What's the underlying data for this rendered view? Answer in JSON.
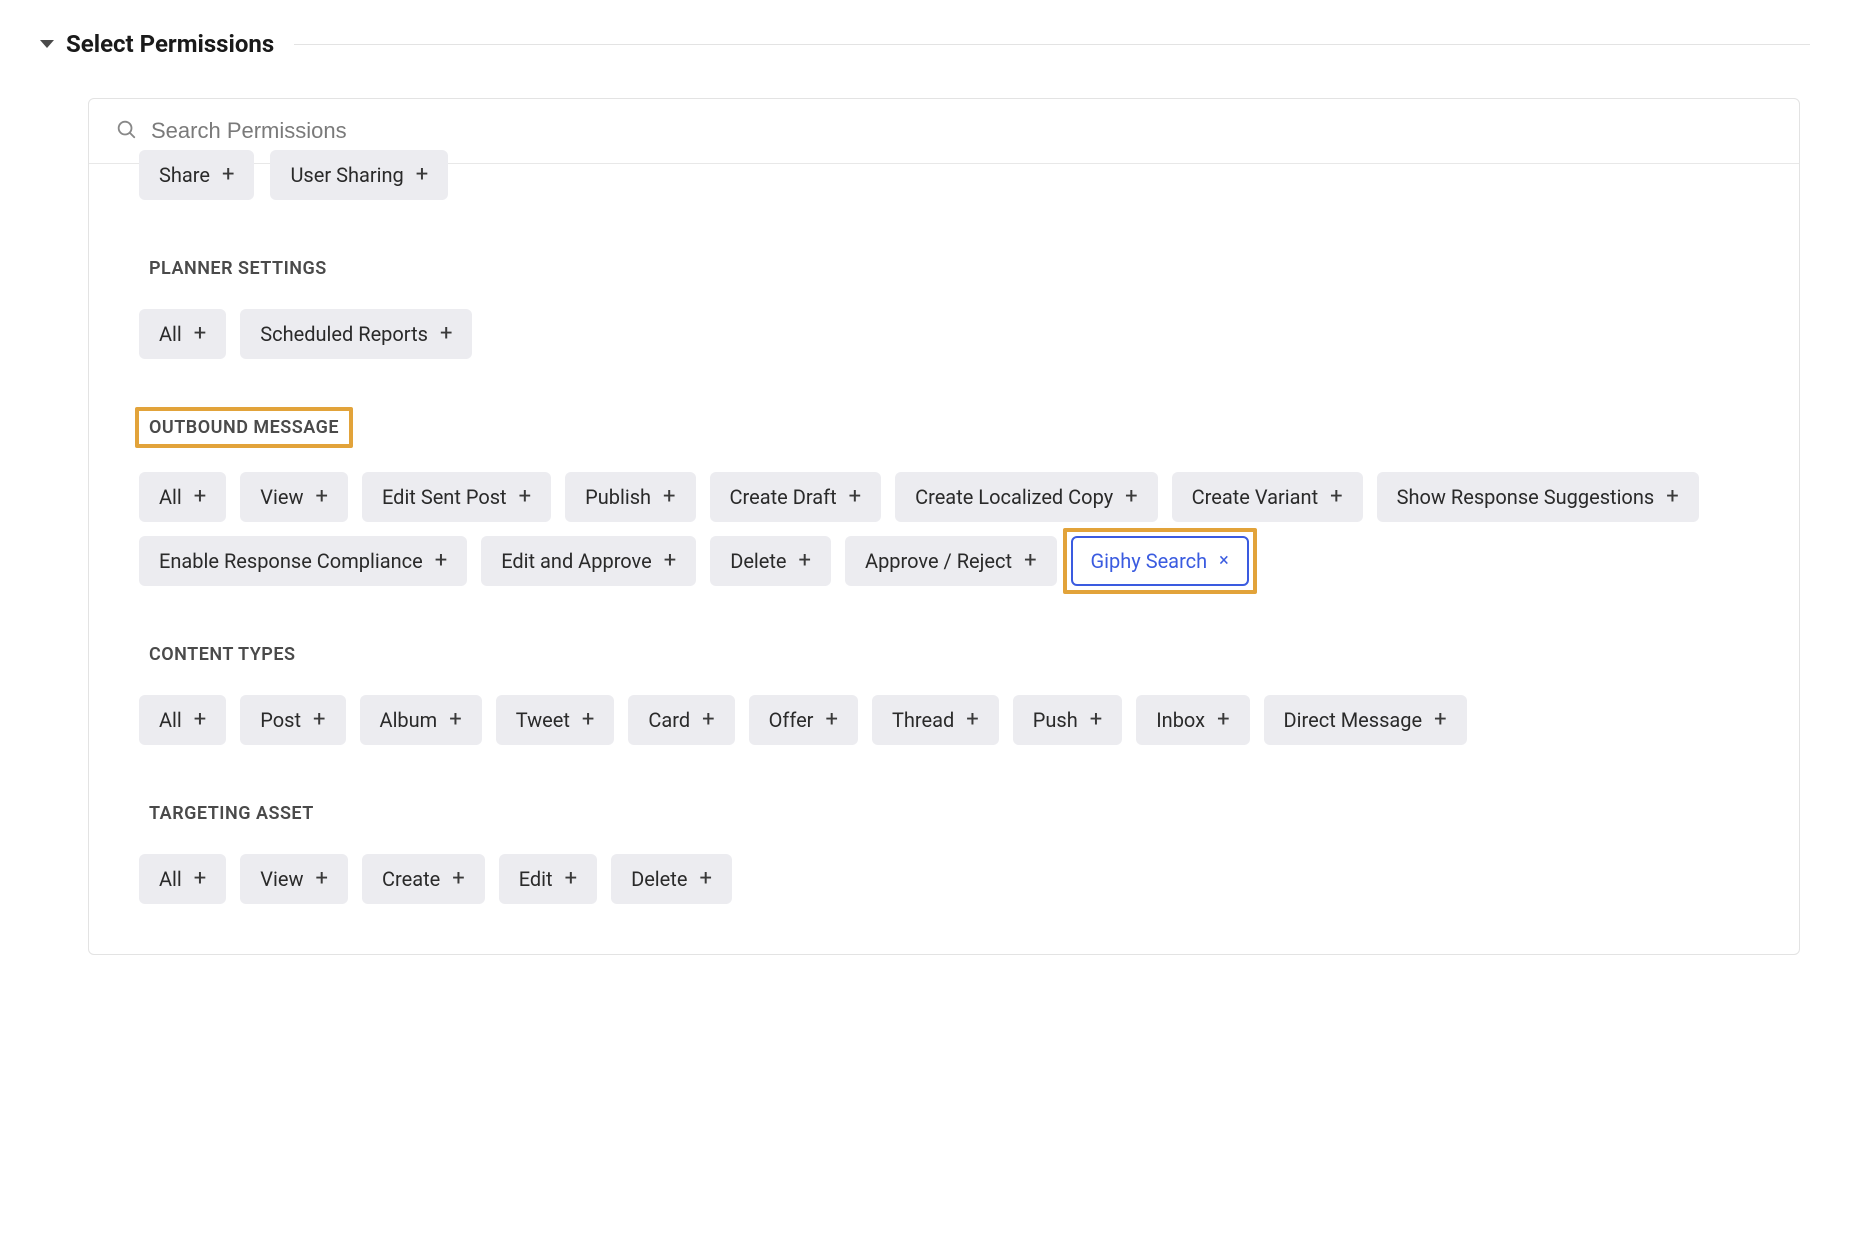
{
  "header": {
    "title": "Select Permissions"
  },
  "search": {
    "placeholder": "Search Permissions"
  },
  "cutoff_row": [
    {
      "label": "Share",
      "icon": "+",
      "selected": false
    },
    {
      "label": "User Sharing",
      "icon": "+",
      "selected": false
    }
  ],
  "groups": [
    {
      "title": "PLANNER SETTINGS",
      "highlighted": false,
      "chips": [
        {
          "label": "All",
          "icon": "+",
          "selected": false,
          "highlighted": false
        },
        {
          "label": "Scheduled Reports",
          "icon": "+",
          "selected": false,
          "highlighted": false
        }
      ]
    },
    {
      "title": "OUTBOUND MESSAGE",
      "highlighted": true,
      "chips": [
        {
          "label": "All",
          "icon": "+",
          "selected": false,
          "highlighted": false
        },
        {
          "label": "View",
          "icon": "+",
          "selected": false,
          "highlighted": false
        },
        {
          "label": "Edit Sent Post",
          "icon": "+",
          "selected": false,
          "highlighted": false
        },
        {
          "label": "Publish",
          "icon": "+",
          "selected": false,
          "highlighted": false
        },
        {
          "label": "Create Draft",
          "icon": "+",
          "selected": false,
          "highlighted": false
        },
        {
          "label": "Create Localized Copy",
          "icon": "+",
          "selected": false,
          "highlighted": false
        },
        {
          "label": "Create Variant",
          "icon": "+",
          "selected": false,
          "highlighted": false
        },
        {
          "label": "Show Response Suggestions",
          "icon": "+",
          "selected": false,
          "highlighted": false
        },
        {
          "label": "Enable Response Compliance",
          "icon": "+",
          "selected": false,
          "highlighted": false
        },
        {
          "label": "Edit and Approve",
          "icon": "+",
          "selected": false,
          "highlighted": false
        },
        {
          "label": "Delete",
          "icon": "+",
          "selected": false,
          "highlighted": false
        },
        {
          "label": "Approve / Reject",
          "icon": "+",
          "selected": false,
          "highlighted": false
        },
        {
          "label": "Giphy Search",
          "icon": "×",
          "selected": true,
          "highlighted": true
        }
      ]
    },
    {
      "title": "CONTENT TYPES",
      "highlighted": false,
      "chips": [
        {
          "label": "All",
          "icon": "+",
          "selected": false,
          "highlighted": false
        },
        {
          "label": "Post",
          "icon": "+",
          "selected": false,
          "highlighted": false
        },
        {
          "label": "Album",
          "icon": "+",
          "selected": false,
          "highlighted": false
        },
        {
          "label": "Tweet",
          "icon": "+",
          "selected": false,
          "highlighted": false
        },
        {
          "label": "Card",
          "icon": "+",
          "selected": false,
          "highlighted": false
        },
        {
          "label": "Offer",
          "icon": "+",
          "selected": false,
          "highlighted": false
        },
        {
          "label": "Thread",
          "icon": "+",
          "selected": false,
          "highlighted": false
        },
        {
          "label": "Push",
          "icon": "+",
          "selected": false,
          "highlighted": false
        },
        {
          "label": "Inbox",
          "icon": "+",
          "selected": false,
          "highlighted": false
        },
        {
          "label": "Direct Message",
          "icon": "+",
          "selected": false,
          "highlighted": false
        }
      ]
    },
    {
      "title": "TARGETING ASSET",
      "highlighted": false,
      "chips": [
        {
          "label": "All",
          "icon": "+",
          "selected": false,
          "highlighted": false
        },
        {
          "label": "View",
          "icon": "+",
          "selected": false,
          "highlighted": false
        },
        {
          "label": "Create",
          "icon": "+",
          "selected": false,
          "highlighted": false
        },
        {
          "label": "Edit",
          "icon": "+",
          "selected": false,
          "highlighted": false
        },
        {
          "label": "Delete",
          "icon": "+",
          "selected": false,
          "highlighted": false
        }
      ]
    }
  ]
}
